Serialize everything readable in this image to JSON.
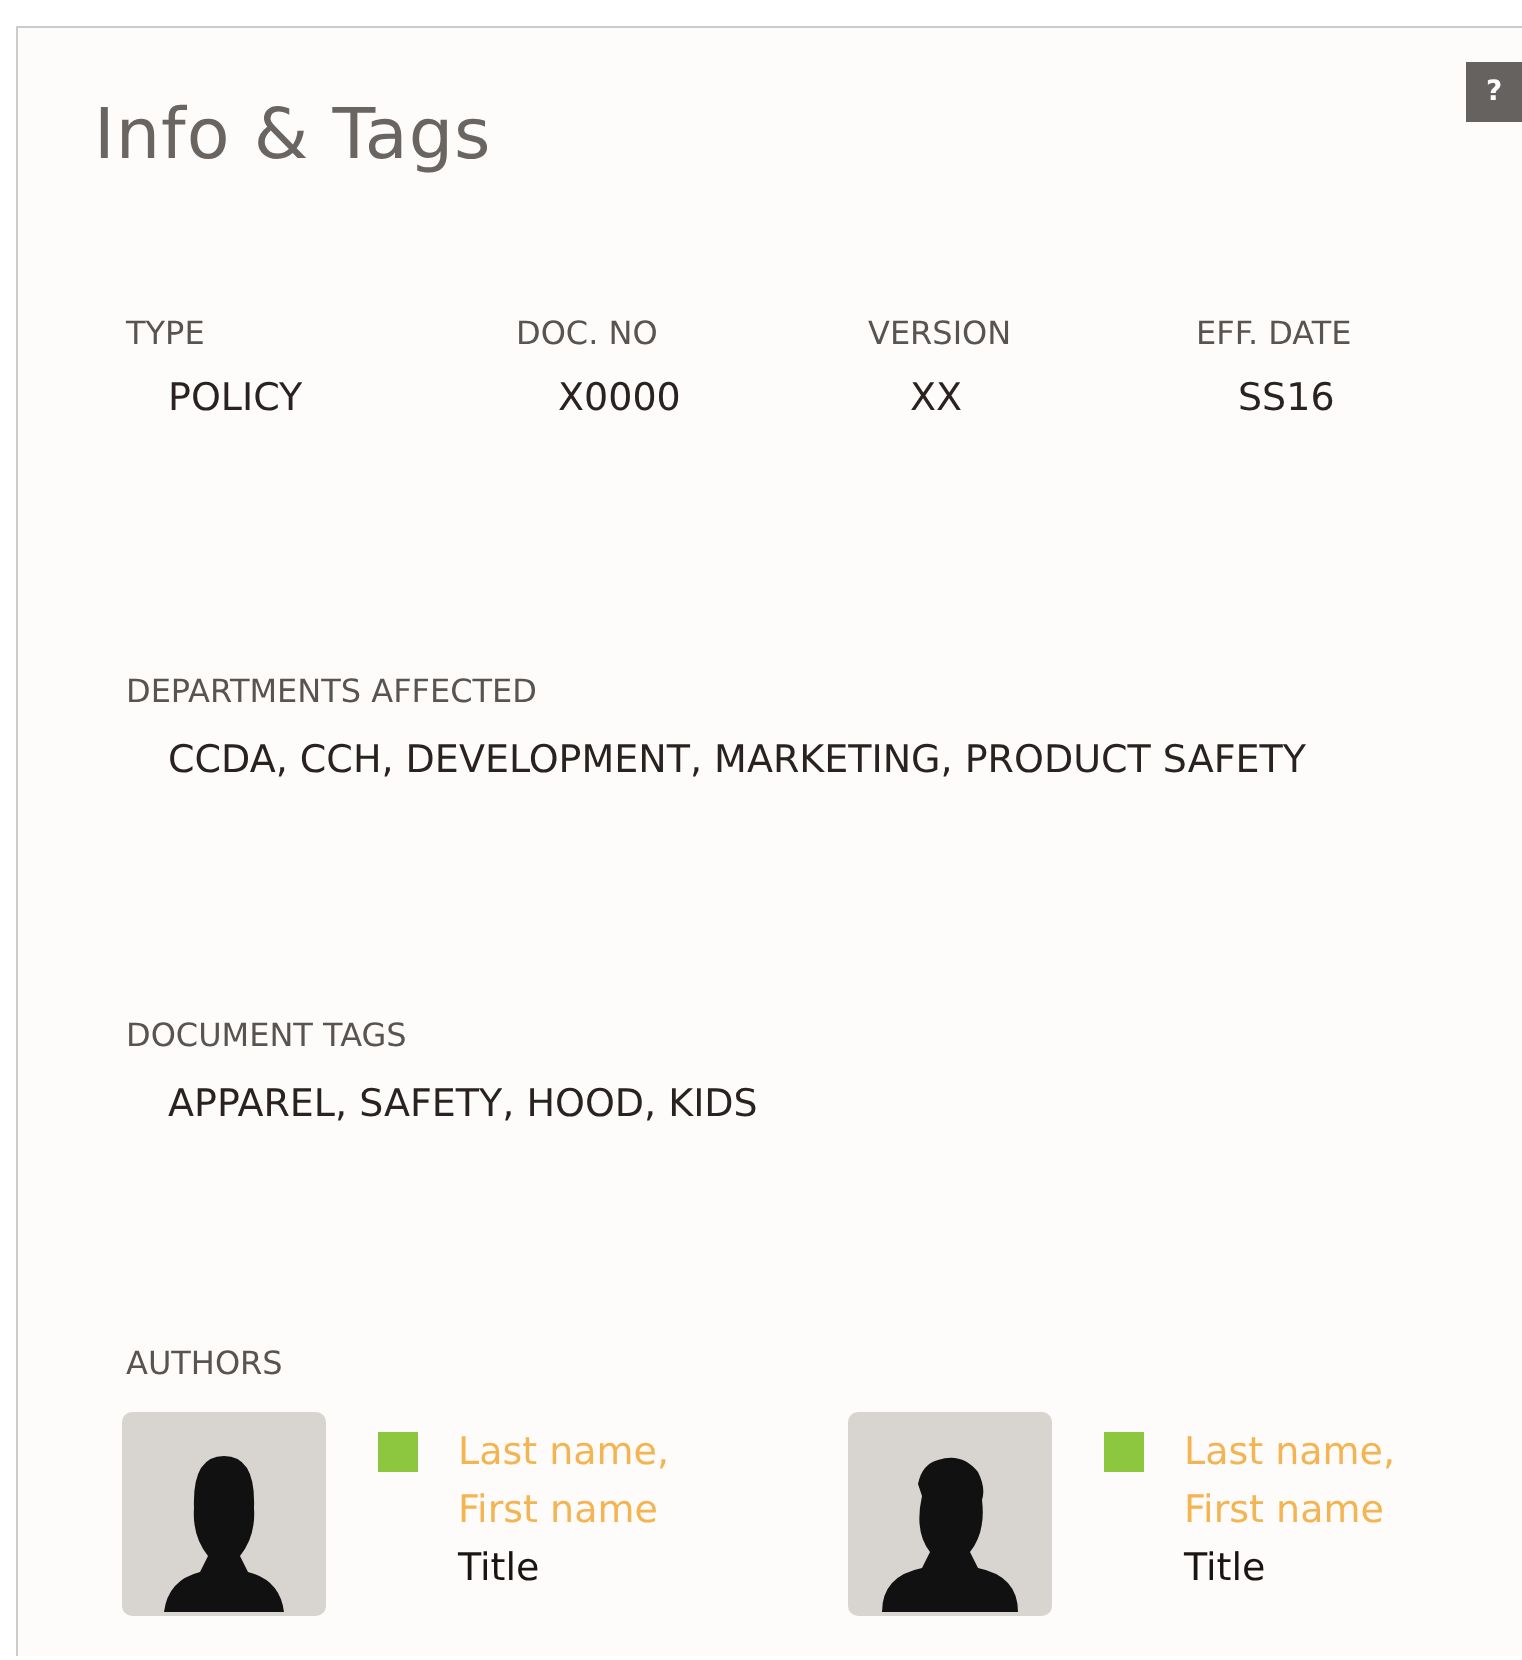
{
  "title": "Info & Tags",
  "help": {
    "label": "?"
  },
  "fields": [
    {
      "label": "TYPE",
      "value": "POLICY"
    },
    {
      "label": "DOC. NO",
      "value": "X0000"
    },
    {
      "label": "VERSION",
      "value": "XX"
    },
    {
      "label": "EFF. DATE",
      "value": "SS16"
    }
  ],
  "departments": {
    "label": "DEPARTMENTS AFFECTED",
    "value": "CCDA, CCH, DEVELOPMENT, MARKETING, PRODUCT SAFETY"
  },
  "tags": {
    "label": "DOCUMENT TAGS",
    "value": "APPAREL, SAFETY, HOOD, KIDS"
  },
  "authors": {
    "label": "AUTHORS",
    "items": [
      {
        "name": "Last name, First name",
        "title": "Title",
        "color": "#8dc63f"
      },
      {
        "name": "Last name, First name",
        "title": "Title",
        "color": "#8dc63f"
      }
    ]
  }
}
